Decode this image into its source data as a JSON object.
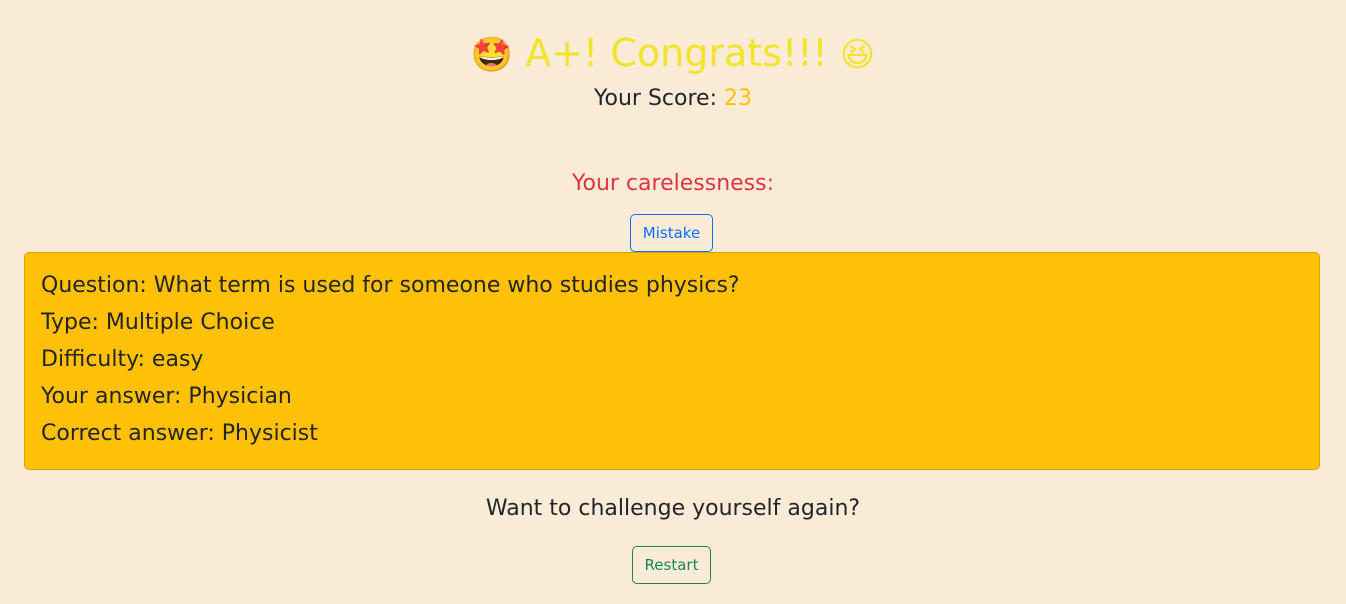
{
  "result": {
    "emoji_left": "🤩",
    "title": "A+! Congrats!!!",
    "emoji_right": "😆",
    "score_label": "Your Score:",
    "score_value": "23"
  },
  "carelessness": {
    "heading": "Your carelessness:",
    "mistake_button": "Mistake",
    "question": "Question: What term is used for someone who studies physics?",
    "type": "Type: Multiple Choice",
    "difficulty": "Difficulty: easy",
    "your_answer": "Your answer: Physician",
    "correct_answer": "Correct answer: Physicist"
  },
  "footer": {
    "prompt": "Want to challenge yourself again?",
    "restart_button": "Restart"
  },
  "colors": {
    "background": "#faebd7",
    "title": "#f2e42c",
    "score": "#ffc107",
    "careless_heading": "#dc3545",
    "panel": "#ffc107",
    "mistake_button": "#0d6efd",
    "restart_button": "#198754"
  }
}
